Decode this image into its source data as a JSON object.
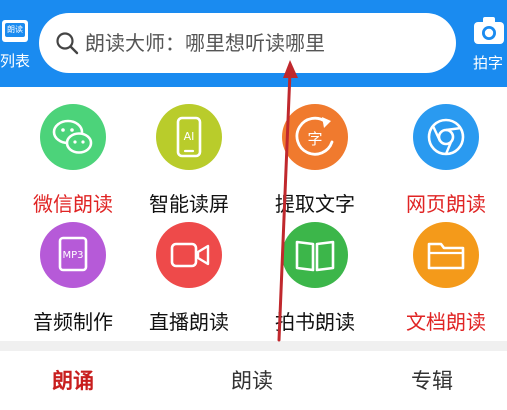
{
  "header": {
    "left_label": "列表",
    "left_badge": "朗读",
    "search_placeholder": "朗读大师：哪里想听读哪里",
    "right_label": "拍字"
  },
  "grid": [
    {
      "label": "微信朗读",
      "icon": "wechat-icon",
      "color": "#4cd37a",
      "label_color": "#e02424"
    },
    {
      "label": "智能读屏",
      "icon": "ai-phone-icon",
      "color": "#b9cc2b",
      "label_color": "#111111"
    },
    {
      "label": "提取文字",
      "icon": "extract-text-icon",
      "color": "#f07a2e",
      "label_color": "#111111"
    },
    {
      "label": "网页朗读",
      "icon": "browser-icon",
      "color": "#2a9af0",
      "label_color": "#e02424"
    },
    {
      "label": "音频制作",
      "icon": "mp3-icon",
      "color": "#b65ad8",
      "label_color": "#111111"
    },
    {
      "label": "直播朗读",
      "icon": "video-camera-icon",
      "color": "#ee4a4a",
      "label_color": "#111111"
    },
    {
      "label": "拍书朗读",
      "icon": "open-book-icon",
      "color": "#3cb64a",
      "label_color": "#111111"
    },
    {
      "label": "文档朗读",
      "icon": "folder-icon",
      "color": "#f49a1a",
      "label_color": "#e02424"
    }
  ],
  "mp3_text": "MP3",
  "ai_text": "AI",
  "extract_char": "字",
  "tabs": [
    {
      "label": "朗诵",
      "active": true
    },
    {
      "label": "朗读",
      "active": false
    },
    {
      "label": "专辑",
      "active": false
    }
  ],
  "annotation_color": "#c0282d"
}
